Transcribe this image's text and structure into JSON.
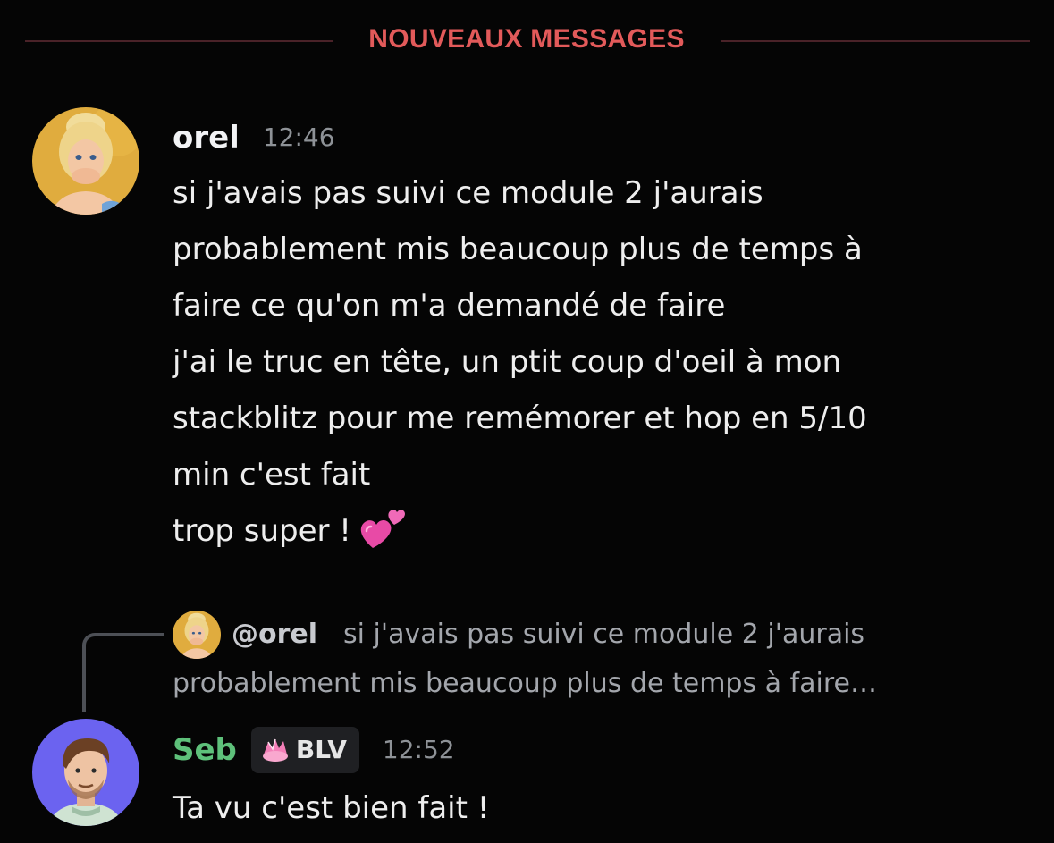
{
  "divider": {
    "label": "NOUVEAUX MESSAGES",
    "color": "#e25a5a"
  },
  "messages": [
    {
      "author": "orel",
      "time": "12:46",
      "avatar_icon": "orel-avatar",
      "lines": [
        "si j'avais pas suivi ce module 2 j'aurais",
        "probablement mis beaucoup plus de temps à",
        "faire ce qu'on m'a demandé de faire",
        "j'ai le truc en tête, un ptit coup d'oeil à mon",
        "stackblitz pour me remémorer et hop en 5/10",
        "min c'est fait",
        "trop super !"
      ],
      "emoji": "two-hearts-emoji"
    },
    {
      "author": "Seb",
      "author_color": "#5ec07a",
      "time": "12:52",
      "tag": "BLV",
      "avatar_icon": "seb-avatar",
      "reply": {
        "mention": "@orel",
        "preview_line_1": "si j'avais pas suivi ce module 2 j'aurais",
        "preview_line_2": "probablement mis beaucoup plus de temps à faire…"
      },
      "text": "Ta vu c'est bien fait !"
    }
  ]
}
